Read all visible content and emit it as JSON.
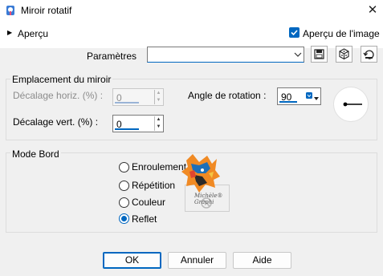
{
  "window": {
    "title": "Miroir rotatif",
    "close_glyph": "✕"
  },
  "preview": {
    "label": "Aperçu",
    "checkbox_label": "Aperçu de l'image",
    "checked": true
  },
  "parameters": {
    "label": "Paramètres",
    "value": ""
  },
  "mirror_group": {
    "title": "Emplacement du miroir",
    "offset_h_label": "Décalage horiz. (%) :",
    "offset_h_value": "0",
    "offset_v_label": "Décalage vert. (%) :",
    "offset_v_value": "0",
    "angle_label": "Angle de rotation :",
    "angle_value": "90"
  },
  "edge_group": {
    "title": "Mode Bord",
    "options": [
      "Enroulement",
      "Répétition",
      "Couleur",
      "Reflet"
    ],
    "selected": "Reflet"
  },
  "watermark_text": "Michèle® Graphi",
  "buttons": {
    "ok": "OK",
    "cancel": "Annuler",
    "help": "Aide"
  },
  "colors": {
    "accent": "#0067c0",
    "background": "#f0f0f0"
  },
  "icons": [
    "app-icon",
    "close-icon",
    "expander-triangle-icon",
    "checkmark-icon",
    "save-preset-icon",
    "randomize-icon",
    "reset-icon",
    "combo-arrow-icon"
  ]
}
